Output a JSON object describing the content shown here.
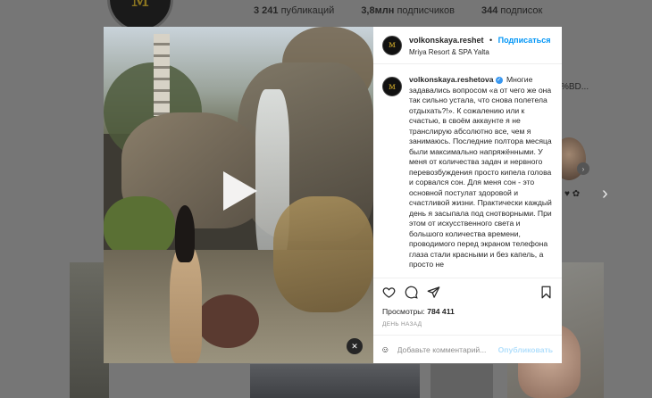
{
  "background": {
    "stats": [
      {
        "count": "3 241",
        "label": "публикаций"
      },
      {
        "count": "3,8млн",
        "label": "подписчиков"
      },
      {
        "count": "344",
        "label": "подписок"
      }
    ],
    "tag_fragment": "%BD...",
    "hearts": "♥ ✿",
    "avatar_glyph": "ᴍ"
  },
  "post": {
    "username": "volkonskaya.reshet",
    "separator": "•",
    "follow_label": "Подписаться",
    "location": "Mriya Resort & SPA Yalta",
    "avatar_glyph": "ᴍ",
    "caption_username": "volkonskaya.reshetova",
    "caption_text": "Многие задавались вопросом «а от чего же она так сильно устала, что снова полетела отдыхать?!». К сожалению или к счастью, в своём аккаунте я не транслирую абсолютно все, чем я занимаюсь. Последние полтора месяца были максимально напряжёнными. У меня от количества задач и нервного перевозбуждения просто кипела голова и сорвался сон. Для меня сон - это основной постулат здоровой и счастливой жизни. Практически каждый день я засыпала под снотворными. При этом от искусственного света и большого количества времени, проводимого перед экраном телефона глаза стали красными и без капель, а просто не",
    "views_label": "Просмотры:",
    "views_count": "784 411",
    "time_ago": "ДЕНЬ НАЗАД",
    "comment_placeholder": "Добавьте комментарий...",
    "publish_label": "Опубликовать"
  },
  "icons": [
    "heart-icon",
    "comment-icon",
    "share-icon",
    "bookmark-icon",
    "emoji-icon",
    "play-icon",
    "mute-icon",
    "verified-icon",
    "next-arrow-icon"
  ],
  "colors": {
    "accent": "#0095f6",
    "publish_disabled": "#b2dffc",
    "verified": "#3897f0"
  }
}
